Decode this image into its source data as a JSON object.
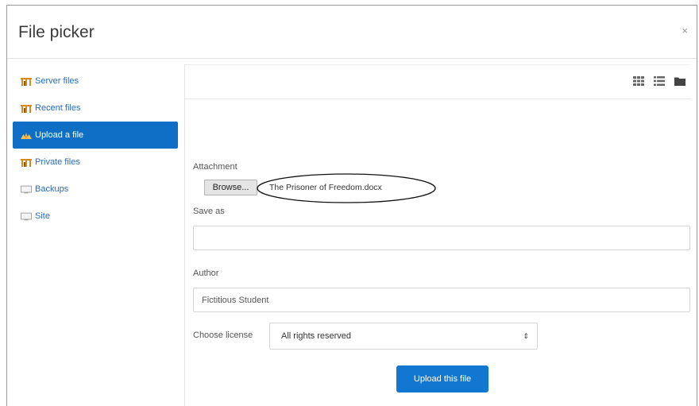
{
  "dialog": {
    "title": "File picker",
    "close_label": "×"
  },
  "sidebar": {
    "items": [
      {
        "label": "Server files",
        "icon": "repository-icon",
        "active": false
      },
      {
        "label": "Recent files",
        "icon": "repository-icon",
        "active": false
      },
      {
        "label": "Upload a file",
        "icon": "upload-icon",
        "active": true
      },
      {
        "label": "Private files",
        "icon": "repository-icon",
        "active": false
      },
      {
        "label": "Backups",
        "icon": "monitor-icon",
        "active": false
      },
      {
        "label": "Site",
        "icon": "monitor-icon",
        "active": false
      }
    ]
  },
  "toolbar": {
    "views": [
      "grid-view-icon",
      "list-view-icon",
      "folder-view-icon"
    ]
  },
  "form": {
    "attachment_label": "Attachment",
    "browse_label": "Browse...",
    "selected_file": "The Prisoner of Freedom.docx",
    "save_as_label": "Save as",
    "save_as_value": "",
    "author_label": "Author",
    "author_value": "Fictitious Student",
    "license_label": "Choose license",
    "license_value": "All rights reserved",
    "upload_label": "Upload this file"
  },
  "colors": {
    "accent": "#0f6fc6",
    "link": "#2a6eb8",
    "repository_icon": "#d98a1e"
  }
}
